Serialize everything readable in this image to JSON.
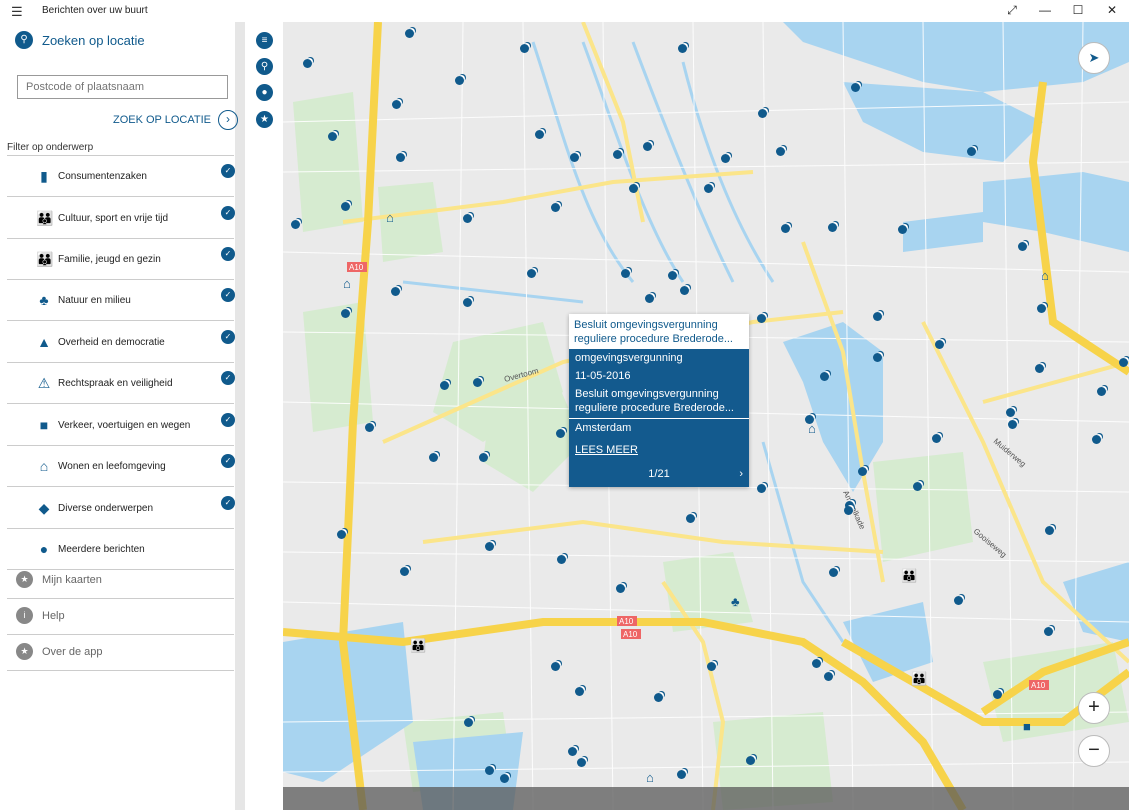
{
  "window": {
    "title": "Berichten over uw buurt",
    "menu_glyph": "☰",
    "controls": {
      "fullscreen": "⤢",
      "minimize": "—",
      "maximize": "☐",
      "close": "✕"
    }
  },
  "search": {
    "heading": "Zoeken op locatie",
    "placeholder": "Postcode of plaatsnaam",
    "button_label": "ZOEK OP LOCATIE",
    "button_glyph": "›"
  },
  "filter": {
    "label": "Filter op onderwerp",
    "categories": [
      {
        "label": "Consumentenzaken",
        "icon": "shopping-bag-icon",
        "glyph": "▮"
      },
      {
        "label": "Cultuur, sport en vrije tijd",
        "icon": "people-icon",
        "glyph": "👪"
      },
      {
        "label": "Familie, jeugd en gezin",
        "icon": "family-icon",
        "glyph": "👪"
      },
      {
        "label": "Natuur en milieu",
        "icon": "tree-icon",
        "glyph": "♣"
      },
      {
        "label": "Overheid en democratie",
        "icon": "government-building-icon",
        "glyph": "▲"
      },
      {
        "label": "Rechtspraak en veiligheid",
        "icon": "car-crash-icon",
        "glyph": "⚠"
      },
      {
        "label": "Verkeer, voertuigen en wegen",
        "icon": "car-icon",
        "glyph": "■"
      },
      {
        "label": "Wonen en leefomgeving",
        "icon": "house-icon",
        "glyph": "⌂"
      },
      {
        "label": "Diverse onderwerpen",
        "icon": "diamond-icon",
        "glyph": "◆"
      },
      {
        "label": "Meerdere berichten",
        "icon": "stacked-pin-icon",
        "glyph": "●"
      }
    ],
    "check_glyph": "✓"
  },
  "bottom_menu": [
    {
      "label": "Mijn kaarten",
      "icon": "star-icon",
      "glyph": "★"
    },
    {
      "label": "Help",
      "icon": "info-icon",
      "glyph": "i"
    },
    {
      "label": "Over de app",
      "icon": "star-icon",
      "glyph": "★"
    }
  ],
  "rail": [
    {
      "icon": "list-icon",
      "glyph": "≡"
    },
    {
      "icon": "search-icon",
      "glyph": "⚲"
    },
    {
      "icon": "chat-icon",
      "glyph": "●"
    },
    {
      "icon": "star-icon",
      "glyph": "★"
    }
  ],
  "popup": {
    "title": "Besluit omgevingsvergunning reguliere procedure Brederode...",
    "type": "omgevingsvergunning",
    "date": "11-05-2016",
    "description": "Besluit omgevingsvergunning reguliere procedure Brederode...",
    "place": "Amsterdam",
    "link": "LEES MEER",
    "pager": "1/21",
    "next_glyph": "›"
  },
  "map": {
    "road_labels": [
      "A10",
      "A10",
      "A10",
      "A10",
      "Overtoom",
      "Amstelkade",
      "Muiderweg",
      "Gooiseweg"
    ],
    "compass_glyph": "➤",
    "zoom_in": "+",
    "zoom_out": "−",
    "colors": {
      "water": "#a8d4f0",
      "motorway": "#f7d34a",
      "road": "#ffffff",
      "main": "#fbe58a",
      "park": "#d6ebd0",
      "accent": "#105a8c"
    }
  }
}
